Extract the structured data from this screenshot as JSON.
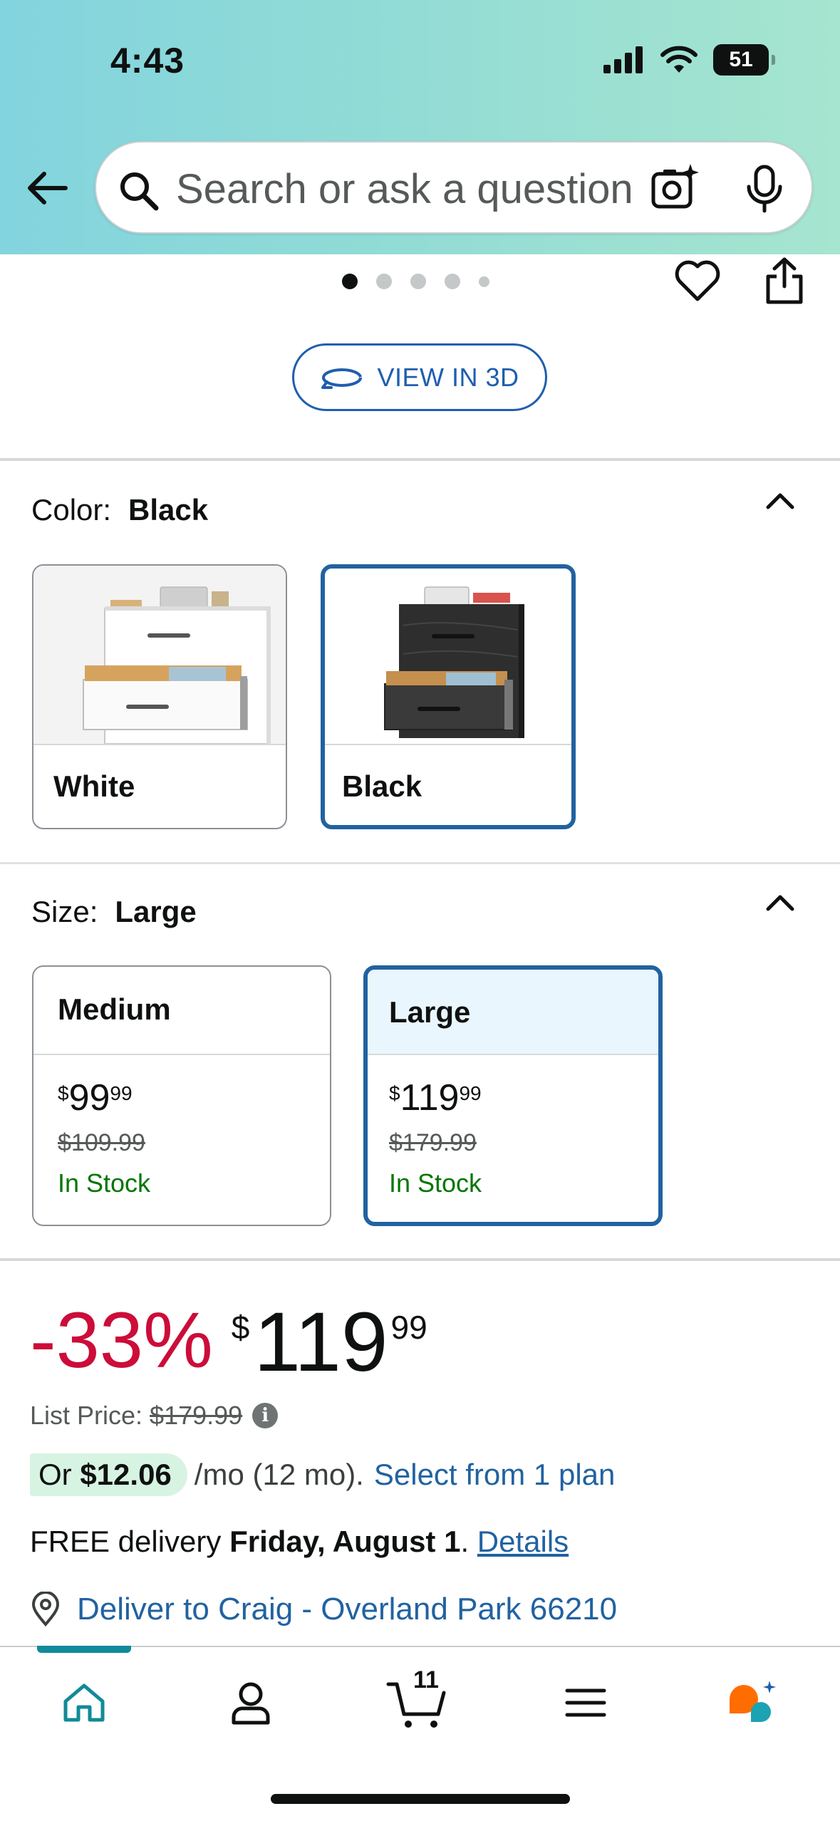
{
  "status_bar": {
    "time": "4:43",
    "battery": "51"
  },
  "search": {
    "placeholder": "Search or ask a question"
  },
  "gallery": {
    "dot_count": 5,
    "active_dot": 1
  },
  "view3d": {
    "label": "VIEW IN 3D"
  },
  "color": {
    "label": "Color:",
    "selected": "Black",
    "options": [
      {
        "name": "White",
        "selected": false
      },
      {
        "name": "Black",
        "selected": true
      }
    ]
  },
  "size": {
    "label": "Size:",
    "selected": "Large",
    "options": [
      {
        "name": "Medium",
        "currency": "$",
        "whole": "99",
        "fraction": "99",
        "old_price": "$109.99",
        "stock": "In Stock",
        "selected": false
      },
      {
        "name": "Large",
        "currency": "$",
        "whole": "119",
        "fraction": "99",
        "old_price": "$179.99",
        "stock": "In Stock",
        "selected": true
      }
    ]
  },
  "price": {
    "discount": "-33%",
    "currency": "$",
    "whole": "119",
    "fraction": "99",
    "list_price_label": "List Price:",
    "list_price": "$179.99"
  },
  "installment": {
    "or": "Or",
    "amount": "$12.06",
    "term": "/mo (12 mo).",
    "link": "Select from 1 plan"
  },
  "delivery": {
    "prefix": "FREE delivery",
    "date": "Friday, August 1",
    "suffix": ".",
    "details_link": "Details"
  },
  "deliver_to": {
    "text": "Deliver to Craig - Overland Park 66210"
  },
  "bottom_nav": {
    "items": [
      "home-icon",
      "account-icon",
      "cart-icon",
      "menu-icon",
      "rufus-icon"
    ],
    "cart_count": "11"
  },
  "colors": {
    "accent_blue": "#2162a1",
    "deal_red": "#cc0c39",
    "stock_green": "#007600",
    "nav_teal": "#118a99"
  }
}
